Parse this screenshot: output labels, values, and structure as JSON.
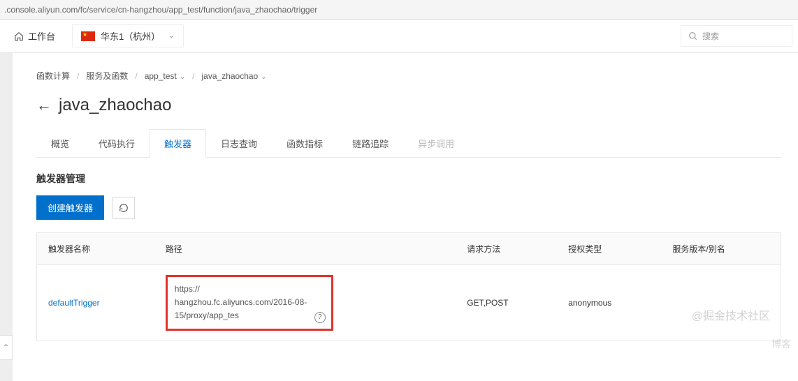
{
  "url": ".console.aliyun.com/fc/service/cn-hangzhou/app_test/function/java_zhaochao/trigger",
  "topbar": {
    "workbench": "工作台",
    "region": "华东1（杭州）",
    "search_placeholder": "搜索"
  },
  "breadcrumbs": {
    "items": [
      "函数计算",
      "服务及函数",
      "app_test",
      "java_zhaochao"
    ],
    "sep": "/"
  },
  "page_title": "java_zhaochao",
  "tabs": [
    {
      "label": "概览",
      "state": "normal"
    },
    {
      "label": "代码执行",
      "state": "normal"
    },
    {
      "label": "触发器",
      "state": "active"
    },
    {
      "label": "日志查询",
      "state": "normal"
    },
    {
      "label": "函数指标",
      "state": "normal"
    },
    {
      "label": "链路追踪",
      "state": "normal"
    },
    {
      "label": "异步调用",
      "state": "disabled"
    }
  ],
  "section_title": "触发器管理",
  "actions": {
    "create": "创建触发器"
  },
  "table": {
    "headers": [
      "触发器名称",
      "路径",
      "请求方法",
      "授权类型",
      "服务版本/别名"
    ],
    "rows": [
      {
        "name": "defaultTrigger",
        "path_line1": "https://　　　　　　　　　　",
        "path_line2": "hangzhou.fc.aliyuncs.com/2016-08-",
        "path_line3": "15/proxy/app_tes　　　　　　",
        "method": "GET,POST",
        "auth": "anonymous",
        "version": ""
      }
    ]
  },
  "watermarks": {
    "w1": "@掘金技术社区",
    "w2": "　　　　博客"
  },
  "icons": {
    "help": "?"
  }
}
